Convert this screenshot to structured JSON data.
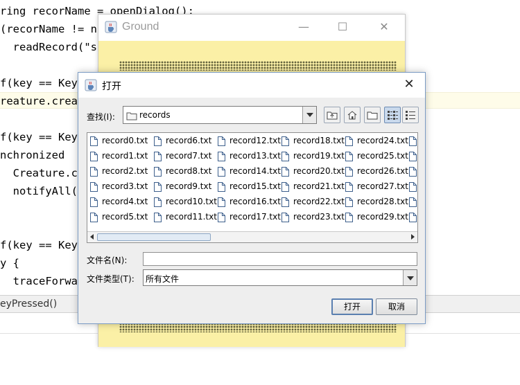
{
  "editor": {
    "lines": [
      "ring recorName = openDialog();",
      "(recorName != nu",
      "  readRecord(\"sr",
      "f(key == Key",
      "reature.creatu",
      "f(key == Key",
      "nchronized",
      "  Creature.cr",
      "  notifyAll()",
      "f(key == Key",
      "y {",
      "  traceForwar"
    ],
    "status_text": "eyPressed()"
  },
  "ground_window": {
    "title": "Ground",
    "controls": {
      "minimize": "—",
      "maximize": "☐",
      "close": "✕"
    },
    "canvas_color": "#fbf0a6",
    "creature_color": "#14c814"
  },
  "open_dialog": {
    "title": "打开",
    "look_in_label": "查找(I):",
    "look_in_value": "records",
    "toolbar_icons": [
      "up-folder-icon",
      "home-icon",
      "new-folder-icon",
      "list-view-icon",
      "details-view-icon"
    ],
    "files": [
      [
        "record0.txt",
        "record1.txt",
        "record2.txt",
        "record3.txt",
        "record4.txt",
        "record5.txt"
      ],
      [
        "record6.txt",
        "record7.txt",
        "record8.txt",
        "record9.txt",
        "record10.txt",
        "record11.txt"
      ],
      [
        "record12.txt",
        "record13.txt",
        "record14.txt",
        "record15.txt",
        "record16.txt",
        "record17.txt"
      ],
      [
        "record18.txt",
        "record19.txt",
        "record20.txt",
        "record21.txt",
        "record22.txt",
        "record23.txt"
      ],
      [
        "record24.txt",
        "record25.txt",
        "record26.txt",
        "record27.txt",
        "record28.txt",
        "record29.txt"
      ]
    ],
    "file_name_label": "文件名(N):",
    "file_name_value": "",
    "file_type_label": "文件类型(T):",
    "file_type_value": "所有文件",
    "open_button": "打开",
    "cancel_button": "取消"
  }
}
